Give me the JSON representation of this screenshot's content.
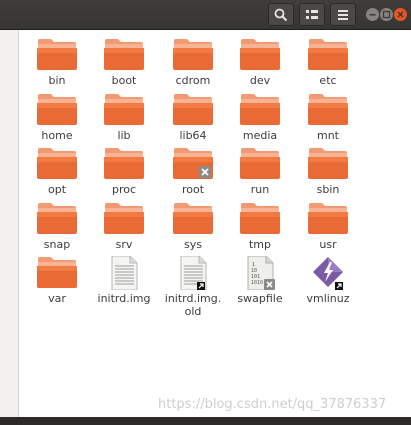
{
  "toolbar": {
    "search_icon": "search-icon",
    "view_icon": "list-view-icon",
    "menu_icon": "hamburger-menu-icon"
  },
  "colors": {
    "titlebar": "#3c3b37",
    "folder_top": "#f7a07a",
    "folder_body": "#e9602d",
    "window_close": "#e95420"
  },
  "items": [
    {
      "label": "bin",
      "type": "folder"
    },
    {
      "label": "boot",
      "type": "folder"
    },
    {
      "label": "cdrom",
      "type": "folder"
    },
    {
      "label": "dev",
      "type": "folder"
    },
    {
      "label": "etc",
      "type": "folder"
    },
    {
      "label": "home",
      "type": "folder"
    },
    {
      "label": "lib",
      "type": "folder"
    },
    {
      "label": "lib64",
      "type": "folder"
    },
    {
      "label": "media",
      "type": "folder"
    },
    {
      "label": "mnt",
      "type": "folder"
    },
    {
      "label": "opt",
      "type": "folder"
    },
    {
      "label": "proc",
      "type": "folder"
    },
    {
      "label": "root",
      "type": "folder-locked"
    },
    {
      "label": "run",
      "type": "folder"
    },
    {
      "label": "sbin",
      "type": "folder"
    },
    {
      "label": "snap",
      "type": "folder"
    },
    {
      "label": "srv",
      "type": "folder"
    },
    {
      "label": "sys",
      "type": "folder"
    },
    {
      "label": "tmp",
      "type": "folder"
    },
    {
      "label": "usr",
      "type": "folder"
    },
    {
      "label": "var",
      "type": "folder"
    },
    {
      "label": "initrd.img",
      "type": "text-file"
    },
    {
      "label": "initrd.img.\nold",
      "type": "text-file-link"
    },
    {
      "label": "swapfile",
      "type": "binary-file-locked"
    },
    {
      "label": "vmlinuz",
      "type": "executable-link"
    }
  ],
  "watermark": "https://blog.csdn.net/qq_37876337"
}
